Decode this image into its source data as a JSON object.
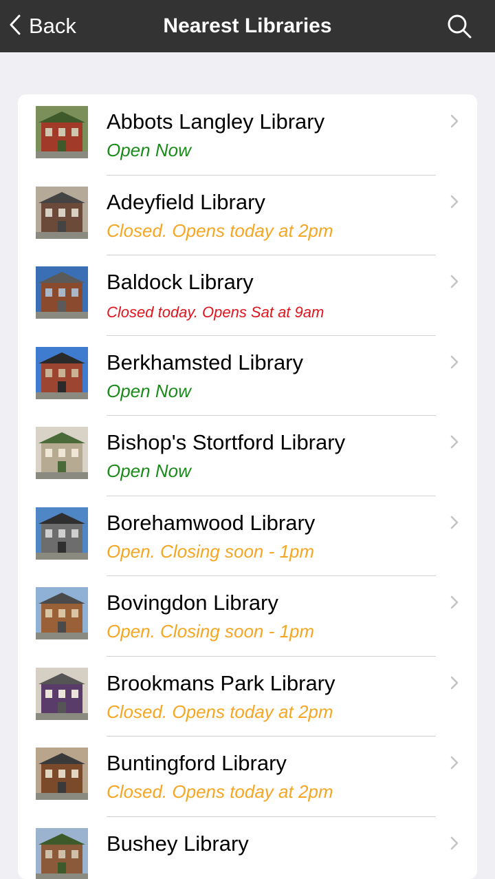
{
  "nav": {
    "back_label": "Back",
    "title": "Nearest Libraries",
    "search_icon": "search-icon",
    "back_icon": "chevron-left-icon"
  },
  "colors": {
    "open": "#1a8a1a",
    "soon": "#f5a623",
    "closed": "#e0141e"
  },
  "libraries": [
    {
      "name": "Abbots Langley Library",
      "status": "Open Now",
      "state": "open"
    },
    {
      "name": "Adeyfield Library",
      "status": "Closed. Opens today at 2pm",
      "state": "soon"
    },
    {
      "name": "Baldock Library",
      "status": "Closed today. Opens Sat at 9am",
      "state": "closed"
    },
    {
      "name": "Berkhamsted Library",
      "status": "Open Now",
      "state": "open"
    },
    {
      "name": "Bishop's Stortford Library",
      "status": "Open Now",
      "state": "open"
    },
    {
      "name": "Borehamwood Library",
      "status": "Open. Closing soon - 1pm",
      "state": "soon"
    },
    {
      "name": "Bovingdon Library",
      "status": "Open. Closing soon - 1pm",
      "state": "soon"
    },
    {
      "name": "Brookmans Park Library",
      "status": "Closed. Opens today at 2pm",
      "state": "soon"
    },
    {
      "name": "Buntingford Library",
      "status": "Closed. Opens today at 2pm",
      "state": "soon"
    },
    {
      "name": "Bushey Library",
      "status": "",
      "state": "open"
    }
  ]
}
